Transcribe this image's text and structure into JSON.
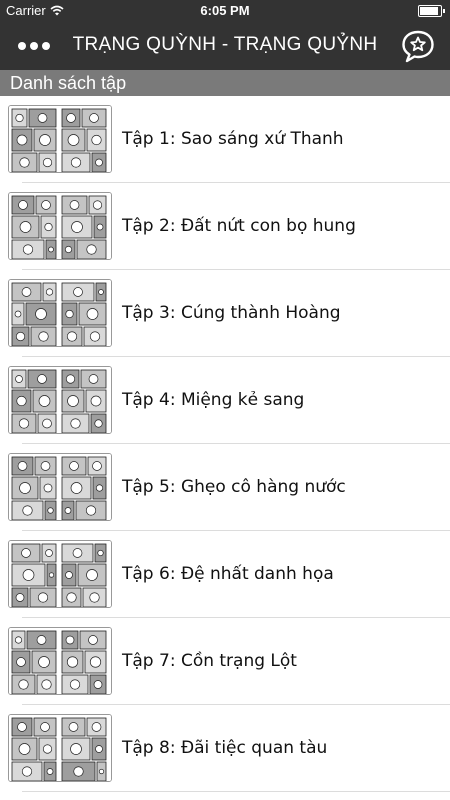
{
  "status": {
    "carrier": "Carrier",
    "time": "6:05 PM"
  },
  "navbar": {
    "title": "TRẠNG QUỲNH - TRẠNG QUỶNH",
    "menu_icon": "ellipsis-icon",
    "right_icon": "star-chat-bubble-icon"
  },
  "section": {
    "title": "Danh sách tập"
  },
  "episodes": [
    {
      "label": "Tập 1: Sao sáng xứ Thanh"
    },
    {
      "label": "Tập 2: Đất nứt con bọ hung"
    },
    {
      "label": "Tập 3: Cúng thành Hoàng"
    },
    {
      "label": "Tập 4: Miệng kẻ sang"
    },
    {
      "label": "Tập 5: Ghẹo cô hàng nước"
    },
    {
      "label": "Tập 6: Đệ nhất danh họa"
    },
    {
      "label": "Tập 7: Cồn trạng Lột"
    },
    {
      "label": "Tập 8: Đãi tiệc quan tàu"
    }
  ],
  "colors": {
    "navbar": "#333333",
    "section_header": "#7a7a7a",
    "divider": "#dcdcdc"
  }
}
